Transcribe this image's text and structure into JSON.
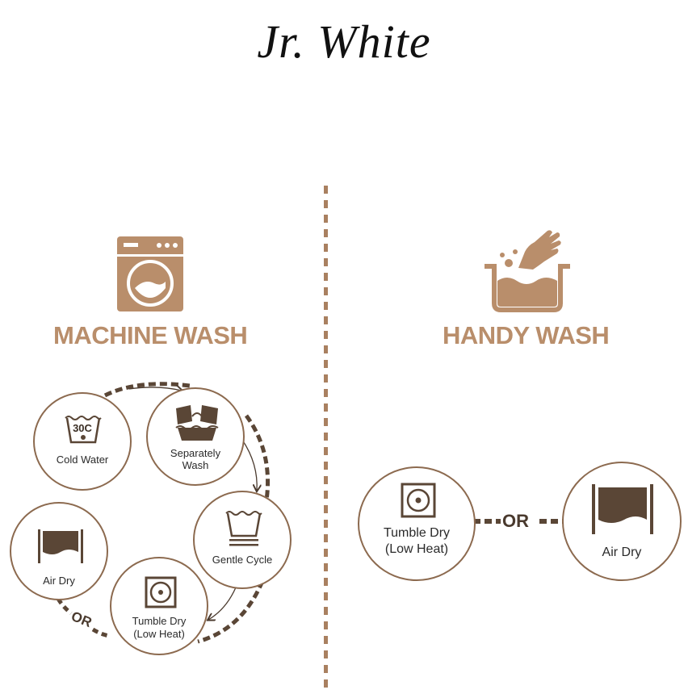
{
  "brand": "Jr. White",
  "colors": {
    "accent": "#b98e6b",
    "dark": "#5a4636",
    "outline": "#8c6a4f"
  },
  "machine": {
    "title": "MACHINE WASH",
    "icon": "washing-machine-icon",
    "steps": {
      "cold_water": {
        "badge": "30C",
        "label": "Cold Water",
        "icon": "wash-30c-icon"
      },
      "separately": {
        "label_1": "Separately",
        "label_2": "Wash",
        "icon": "separate-wash-icon"
      },
      "gentle": {
        "label": "Gentle Cycle",
        "icon": "gentle-cycle-icon"
      },
      "tumble": {
        "label_1": "Tumble Dry",
        "label_2": "(Low Heat)",
        "icon": "tumble-dry-icon"
      },
      "air": {
        "label": "Air Dry",
        "icon": "air-dry-icon"
      }
    },
    "or": "OR"
  },
  "hand": {
    "title": "HANDY WASH",
    "icon": "hand-wash-icon",
    "tumble": {
      "label_1": "Tumble Dry",
      "label_2": "(Low Heat)",
      "icon": "tumble-dry-icon"
    },
    "air": {
      "label": "Air Dry",
      "icon": "air-dry-icon"
    },
    "or": "OR"
  }
}
